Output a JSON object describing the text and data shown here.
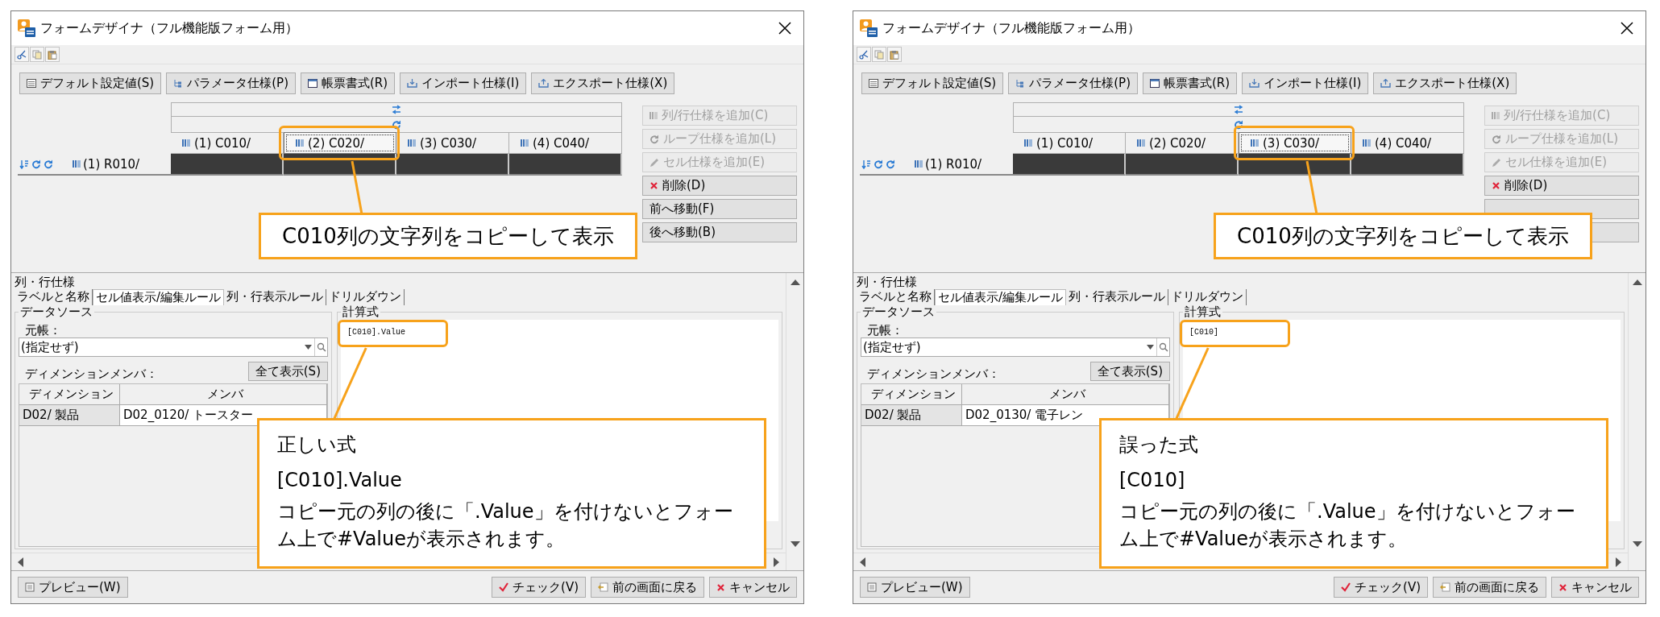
{
  "panels": [
    {
      "window": {
        "title": "フォームデザイナ（フル機能版フォーム用）"
      },
      "commands": [
        "デフォルト設定値(S)",
        "パラメータ仕様(P)",
        "帳票書式(R)",
        "インポート仕様(I)",
        "エクスポート仕様(X)"
      ],
      "grid": {
        "columns": [
          {
            "label": "(1) C010/",
            "selected": false
          },
          {
            "label": "(2) C020/",
            "selected": true
          },
          {
            "label": "(3) C030/",
            "selected": false
          },
          {
            "label": "(4) C040/",
            "selected": false
          }
        ],
        "rows": [
          {
            "label": "(1) R010/"
          }
        ]
      },
      "side_buttons": [
        {
          "label": "列/行仕様を追加(C)",
          "disabled": true
        },
        {
          "label": "ループ仕様を追加(L)",
          "disabled": true
        },
        {
          "label": "セル仕様を追加(E)",
          "disabled": true
        },
        {
          "label": "削除(D)",
          "disabled": false
        },
        {
          "label": "前へ移動(F)",
          "disabled": false
        },
        {
          "label": "後へ移動(B)",
          "disabled": false
        }
      ],
      "section_title": "列・行仕様",
      "tabs": [
        {
          "label": "ラベルと名称",
          "selected": false
        },
        {
          "label": "セル値表示/編集ルール",
          "selected": true
        },
        {
          "label": "列・行表示ルール",
          "selected": false
        },
        {
          "label": "ドリルダウン",
          "selected": false
        }
      ],
      "data_source": {
        "legend": "データソース",
        "ledger_label": "元帳：",
        "ledger_value": "(指定せず)",
        "members_label": "ディメンションメンバ：",
        "show_all_button": "全て表示(S)",
        "table": {
          "columns": [
            "ディメンション",
            "メンバ"
          ],
          "rows": [
            [
              "D02/ 製品",
              "D02_0120/ トースター"
            ]
          ]
        }
      },
      "formula": {
        "legend": "計算式",
        "value": "[C010].Value"
      },
      "footer": {
        "preview_button": "プレビュー(W)",
        "buttons": [
          "チェック(V)",
          "前の画面に戻る",
          "キャンセル"
        ]
      },
      "callouts": {
        "column_note": "C010列の文字列をコピーして表示",
        "formula_note": {
          "title": "正しい式",
          "formula": "[C010].Value",
          "explanation": "コピー元の列の後に「.Value」を付けないとフォーム上で#Valueが表示されます。"
        }
      }
    },
    {
      "window": {
        "title": "フォームデザイナ（フル機能版フォーム用）"
      },
      "commands": [
        "デフォルト設定値(S)",
        "パラメータ仕様(P)",
        "帳票書式(R)",
        "インポート仕様(I)",
        "エクスポート仕様(X)"
      ],
      "grid": {
        "columns": [
          {
            "label": "(1) C010/",
            "selected": false
          },
          {
            "label": "(2) C020/",
            "selected": false
          },
          {
            "label": "(3) C030/",
            "selected": true
          },
          {
            "label": "(4) C040/",
            "selected": false
          }
        ],
        "rows": [
          {
            "label": "(1) R010/"
          }
        ]
      },
      "side_buttons": [
        {
          "label": "列/行仕様を追加(C)",
          "disabled": true
        },
        {
          "label": "ループ仕様を追加(L)",
          "disabled": true
        },
        {
          "label": "セル仕様を追加(E)",
          "disabled": true
        },
        {
          "label": "削除(D)",
          "disabled": false
        },
        {
          "disabled": false
        },
        {
          "disabled": false
        }
      ],
      "section_title": "列・行仕様",
      "tabs": [
        {
          "label": "ラベルと名称",
          "selected": false
        },
        {
          "label": "セル値表示/編集ルール",
          "selected": true
        },
        {
          "label": "列・行表示ルール",
          "selected": false
        },
        {
          "label": "ドリルダウン",
          "selected": false
        }
      ],
      "data_source": {
        "legend": "データソース",
        "ledger_label": "元帳：",
        "ledger_value": "(指定せず)",
        "members_label": "ディメンションメンバ：",
        "show_all_button": "全て表示(S)",
        "table": {
          "columns": [
            "ディメンション",
            "メンバ"
          ],
          "rows": [
            [
              "D02/ 製品",
              "D02_0130/ 電子レン"
            ]
          ]
        }
      },
      "formula": {
        "legend": "計算式",
        "value": "[C010]"
      },
      "footer": {
        "preview_button": "プレビュー(W)",
        "buttons": [
          "チェック(V)",
          "前の画面に戻る",
          "キャンセル"
        ]
      },
      "callouts": {
        "column_note": "C010列の文字列をコピーして表示",
        "formula_note": {
          "title": "誤った式",
          "formula": "[C010]",
          "explanation": "コピー元の列の後に「.Value」を付けないとフォーム上で#Valueが表示されます。"
        }
      }
    }
  ]
}
